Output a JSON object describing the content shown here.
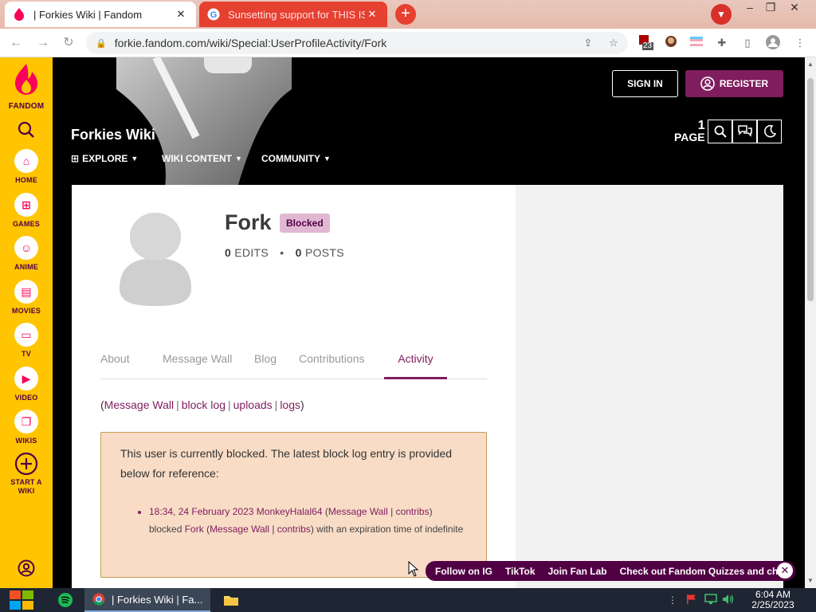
{
  "browser": {
    "tabs": [
      {
        "title": "| Forkies Wiki | Fandom",
        "active": true
      },
      {
        "title": "Sunsetting support for THIS IS",
        "active": false
      }
    ],
    "url": "forkie.fandom.com/wiki/Special:UserProfileActivity/Fork",
    "extension_badge": "23"
  },
  "sidebar": {
    "logo_label": "FANDOM",
    "items": [
      {
        "label": "HOME"
      },
      {
        "label": "GAMES"
      },
      {
        "label": "ANIME"
      },
      {
        "label": "MOVIES"
      },
      {
        "label": "TV"
      },
      {
        "label": "VIDEO"
      },
      {
        "label": "WIKIS"
      },
      {
        "label": "START A WIKI"
      }
    ]
  },
  "header": {
    "sign_in": "SIGN IN",
    "register": "REGISTER",
    "wiki_title": "Forkies Wiki",
    "nav": [
      {
        "label": "EXPLORE"
      },
      {
        "label": "WIKI CONTENT"
      },
      {
        "label": "COMMUNITY"
      }
    ],
    "page_count": "1",
    "page_label": "PAGE"
  },
  "profile": {
    "username": "Fork",
    "badge": "Blocked",
    "edits_count": "0",
    "edits_label": "EDITS",
    "posts_count": "0",
    "posts_label": "POSTS",
    "tabs": [
      {
        "label": "About"
      },
      {
        "label": "Message Wall"
      },
      {
        "label": "Blog"
      },
      {
        "label": "Contributions"
      },
      {
        "label": "Activity",
        "active": true
      }
    ],
    "links": [
      "Message Wall",
      "block log",
      "uploads",
      "logs"
    ]
  },
  "block_notice": {
    "intro": "This user is currently blocked. The latest block log entry is provided below for reference:",
    "entry": {
      "timestamp": "18:34, 24 February 2023",
      "admin": "MonkeyHalal64",
      "admin_wall": "Message Wall",
      "admin_contribs": "contribs",
      "verb": "blocked",
      "target": "Fork",
      "target_wall": "Message Wall",
      "target_contribs": "contribs",
      "tail": "with an expiration time of indefinite"
    }
  },
  "social_bar": {
    "items": [
      "Follow on IG",
      "TikTok",
      "Join Fan Lab",
      "Check out Fandom Quizzes and cha"
    ]
  },
  "taskbar": {
    "chrome_label": "| Forkies Wiki | Fa...",
    "time": "6:04 AM",
    "date": "2/25/2023"
  },
  "colors": {
    "fandom_yellow": "#ffc500",
    "fandom_magenta": "#7f1d5e",
    "fandom_dark": "#520044",
    "block_box": "#f8dcc6"
  }
}
